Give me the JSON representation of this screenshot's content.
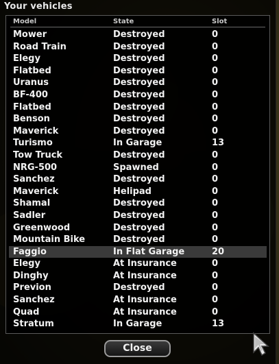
{
  "dialog": {
    "title": "Your vehicles",
    "columns": {
      "model": "Model",
      "state": "State",
      "slot": "Slot"
    },
    "selected_index": 18,
    "rows": [
      {
        "model": "Mower",
        "state": "Destroyed",
        "slot": "0"
      },
      {
        "model": "Road Train",
        "state": "Destroyed",
        "slot": "0"
      },
      {
        "model": "Elegy",
        "state": "Destroyed",
        "slot": "0"
      },
      {
        "model": "Flatbed",
        "state": "Destroyed",
        "slot": "0"
      },
      {
        "model": "Uranus",
        "state": "Destroyed",
        "slot": "0"
      },
      {
        "model": "BF-400",
        "state": "Destroyed",
        "slot": "0"
      },
      {
        "model": "Flatbed",
        "state": "Destroyed",
        "slot": "0"
      },
      {
        "model": "Benson",
        "state": "Destroyed",
        "slot": "0"
      },
      {
        "model": "Maverick",
        "state": "Destroyed",
        "slot": "0"
      },
      {
        "model": "Turismo",
        "state": "In Garage",
        "slot": "13"
      },
      {
        "model": "Tow Truck",
        "state": "Destroyed",
        "slot": "0"
      },
      {
        "model": "NRG-500",
        "state": "Spawned",
        "slot": "0"
      },
      {
        "model": "Sanchez",
        "state": "Destroyed",
        "slot": "0"
      },
      {
        "model": "Maverick",
        "state": "Helipad",
        "slot": "0"
      },
      {
        "model": "Shamal",
        "state": "Destroyed",
        "slot": "0"
      },
      {
        "model": "Sadler",
        "state": "Destroyed",
        "slot": "0"
      },
      {
        "model": "Greenwood",
        "state": "Destroyed",
        "slot": "0"
      },
      {
        "model": "Mountain Bike",
        "state": "Destroyed",
        "slot": "0"
      },
      {
        "model": "Faggio",
        "state": "In Flat Garage",
        "slot": "20"
      },
      {
        "model": "Elegy",
        "state": "At Insurance",
        "slot": "0"
      },
      {
        "model": "Dinghy",
        "state": "At Insurance",
        "slot": "0"
      },
      {
        "model": "Previon",
        "state": "Destroyed",
        "slot": "0"
      },
      {
        "model": "Sanchez",
        "state": "At Insurance",
        "slot": "0"
      },
      {
        "model": "Quad",
        "state": "At Insurance",
        "slot": "0"
      },
      {
        "model": "Stratum",
        "state": "In Garage",
        "slot": "13"
      }
    ],
    "close_label": "Close"
  },
  "colors": {
    "text": "#f2f2f2",
    "header_text": "#c8c8c8",
    "selected_row_bg": "#3a3a3a",
    "panel_border": "#5a5a5a"
  },
  "icons": {
    "cursor": "cursor-arrow-icon"
  }
}
